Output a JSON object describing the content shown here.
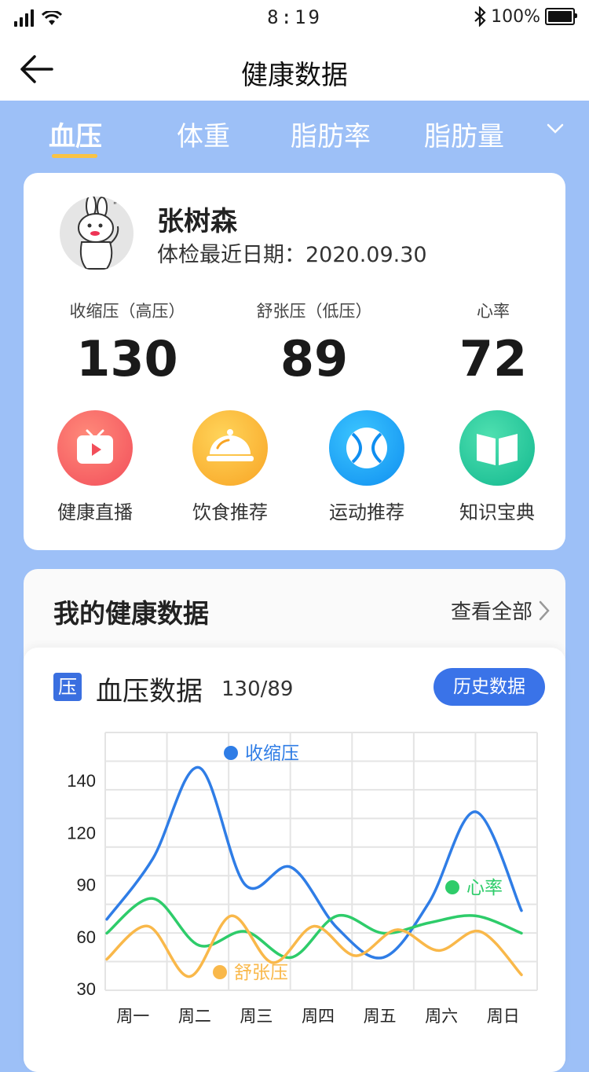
{
  "status_bar": {
    "time": "8:19",
    "battery": "100%"
  },
  "nav": {
    "title": "健康数据"
  },
  "tabs": [
    {
      "label": "血压",
      "active": true
    },
    {
      "label": "体重",
      "active": false
    },
    {
      "label": "脂肪率",
      "active": false
    },
    {
      "label": "脂肪量",
      "active": false
    }
  ],
  "profile": {
    "name": "张树森",
    "date_label": "体检最近日期：",
    "date": "2020.09.30"
  },
  "metrics": [
    {
      "label": "收缩压（高压）",
      "value": "130"
    },
    {
      "label": "舒张压（低压）",
      "value": "89"
    },
    {
      "label": "心率",
      "value": "72"
    }
  ],
  "quick_links": [
    {
      "label": "健康直播",
      "icon": "tv-play-icon",
      "color": "#f55a5a"
    },
    {
      "label": "饮食推荐",
      "icon": "food-cloche-icon",
      "color": "#f9b233"
    },
    {
      "label": "运动推荐",
      "icon": "ball-icon",
      "color": "#1aa8f5"
    },
    {
      "label": "知识宝典",
      "icon": "book-icon",
      "color": "#22c9a0"
    }
  ],
  "health_section": {
    "title": "我的健康数据",
    "more": "查看全部"
  },
  "bp_card": {
    "badge": "压",
    "title": "血压数据",
    "value": "130/89",
    "history_button": "历史数据"
  },
  "chart_data": {
    "type": "line",
    "categories": [
      "周一",
      "周二",
      "周三",
      "周四",
      "周五",
      "周六",
      "周日"
    ],
    "y_ticks": [
      30,
      60,
      90,
      120,
      140
    ],
    "series": [
      {
        "name": "收缩压",
        "color": "#2f7de6",
        "values": [
          70,
          105,
          145,
          90,
          100,
          65,
          48,
          80,
          128,
          75
        ]
      },
      {
        "name": "心率",
        "color": "#2ecc6a",
        "values": [
          62,
          82,
          55,
          63,
          48,
          72,
          62,
          68,
          72,
          62
        ]
      },
      {
        "name": "舒张压",
        "color": "#f9b84a",
        "values": [
          47,
          66,
          37,
          72,
          45,
          66,
          49,
          64,
          52,
          63,
          38
        ]
      }
    ],
    "grid": true
  }
}
